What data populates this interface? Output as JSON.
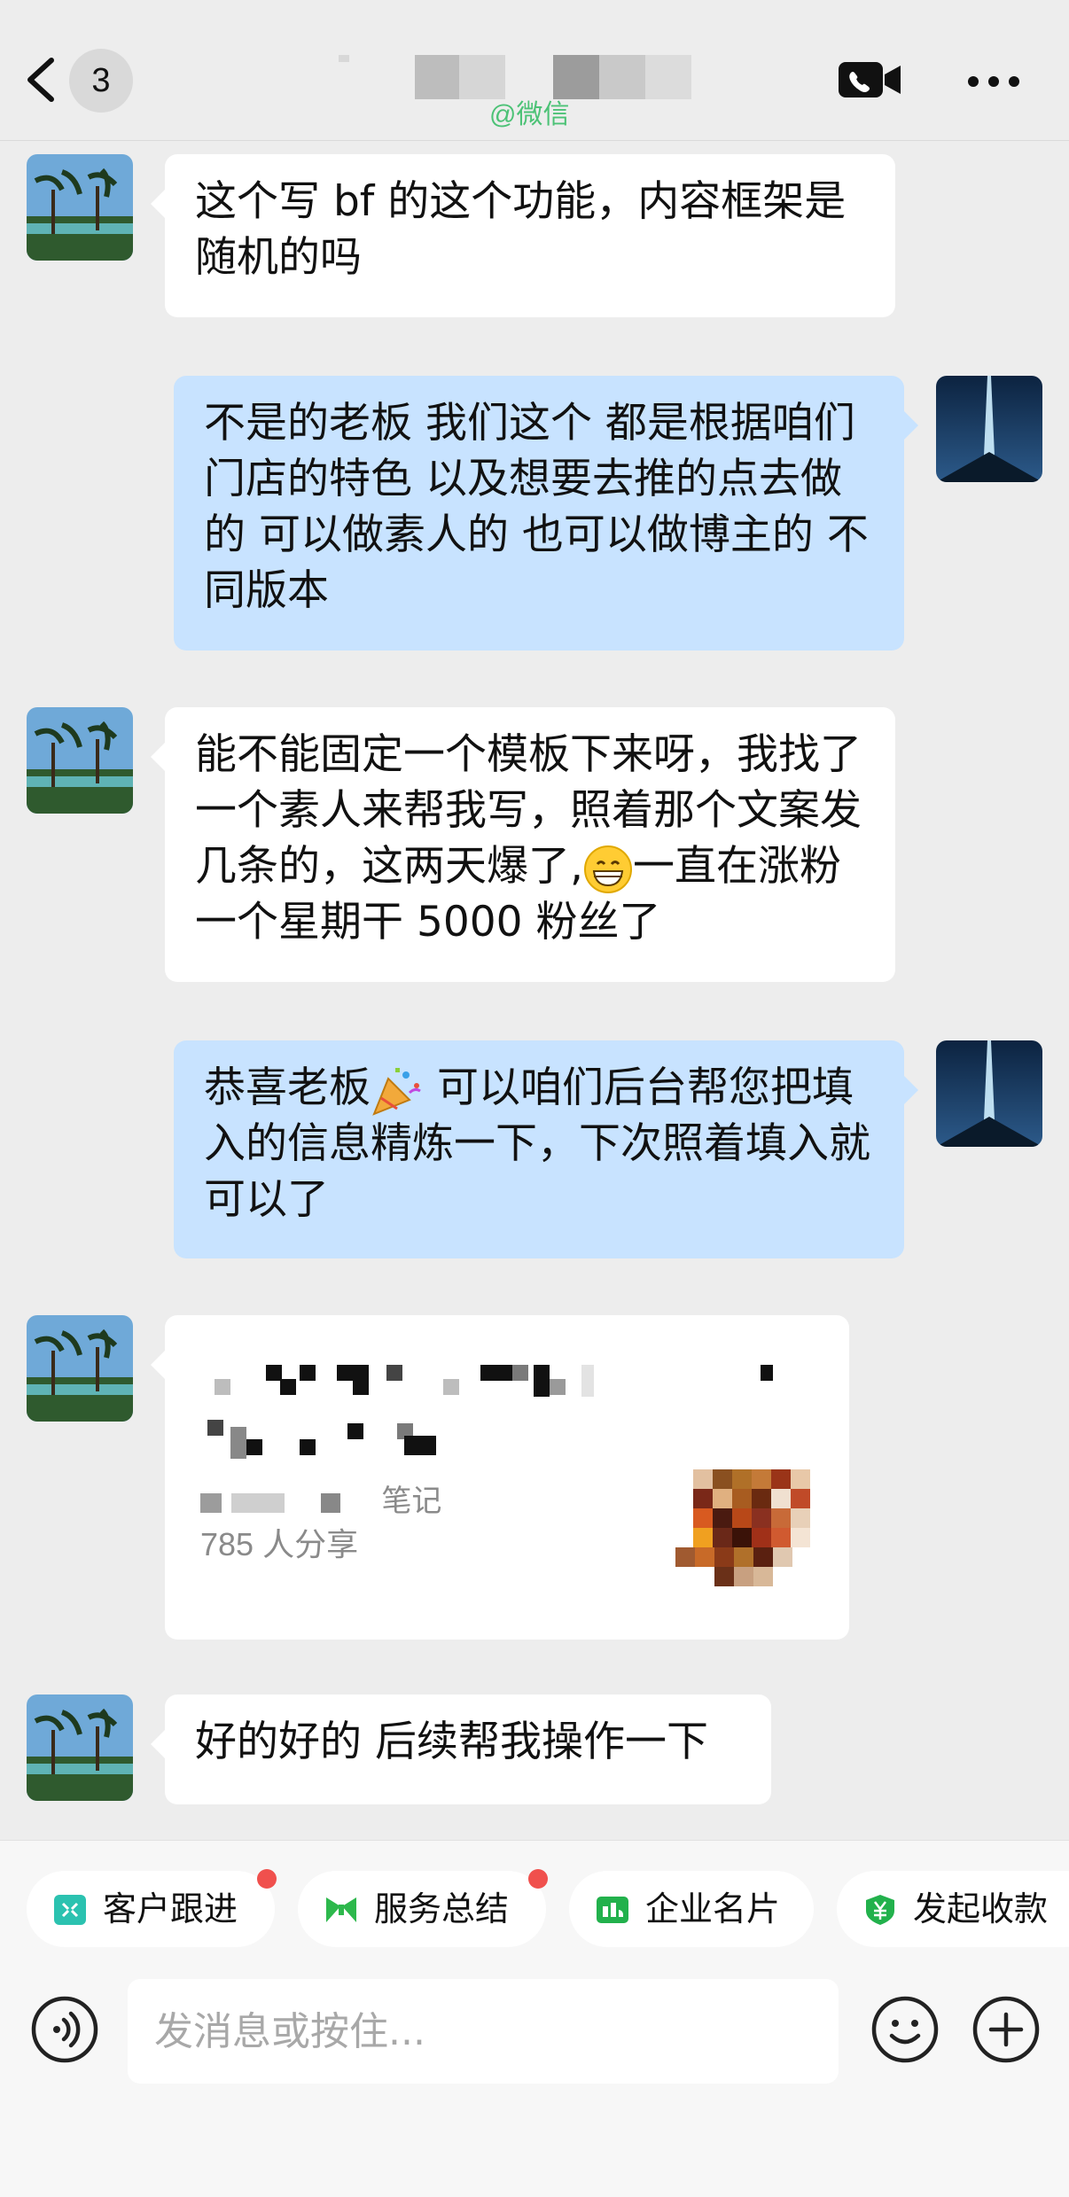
{
  "header": {
    "unread_count": "3",
    "subtitle": "@微信"
  },
  "messages": [
    {
      "direction": "in",
      "text": "这个写 bf 的这个功能，内容框架是随机的吗"
    },
    {
      "direction": "out",
      "text": "不是的老板 我们这个 都是根据咱们门店的特色 以及想要去推的点去做的 可以做素人的 也可以做博主的 不同版本"
    },
    {
      "direction": "in",
      "text_before_emoji": "能不能固定一个模板下来呀，我找了一个素人来帮我写，照着那个文案发几条的，这两天爆了,",
      "emoji": "grinning-face-emoji",
      "text_after_emoji": "一直在涨粉 一个星期干 5000 粉丝了"
    },
    {
      "direction": "out",
      "text_before_emoji": "恭喜老板",
      "emoji": "party-popper-emoji",
      "text_after_emoji": " 可以咱们后台帮您把填入的信息精炼一下，下次照着填入就可以了"
    },
    {
      "direction": "in",
      "type": "link-card",
      "source_partial": "笔记",
      "share_count": "785 人分享"
    },
    {
      "direction": "in",
      "text": "好的好的 后续帮我操作一下"
    }
  ],
  "quick_actions": [
    {
      "label": "客户跟进",
      "icon": "customer-follow-icon",
      "icon_color": "#2BC2B0",
      "has_dot": true
    },
    {
      "label": "服务总结",
      "icon": "service-summary-icon",
      "icon_color": "#2DB84C",
      "has_dot": true
    },
    {
      "label": "企业名片",
      "icon": "business-card-icon",
      "icon_color": "#22B14C",
      "has_dot": false
    },
    {
      "label": "发起收款",
      "icon": "collect-payment-icon",
      "icon_color": "#22B14C",
      "has_dot": false
    }
  ],
  "composer": {
    "placeholder": "发消息或按住...",
    "icons": [
      "voice-icon",
      "emoji-icon",
      "plus-icon"
    ]
  },
  "colors": {
    "background": "#EDEDED",
    "incoming_bubble": "#FFFFFF",
    "outgoing_bubble": "#C8E3FF",
    "badge_dot": "#F0504D",
    "wechat_green": "#4CC276"
  }
}
